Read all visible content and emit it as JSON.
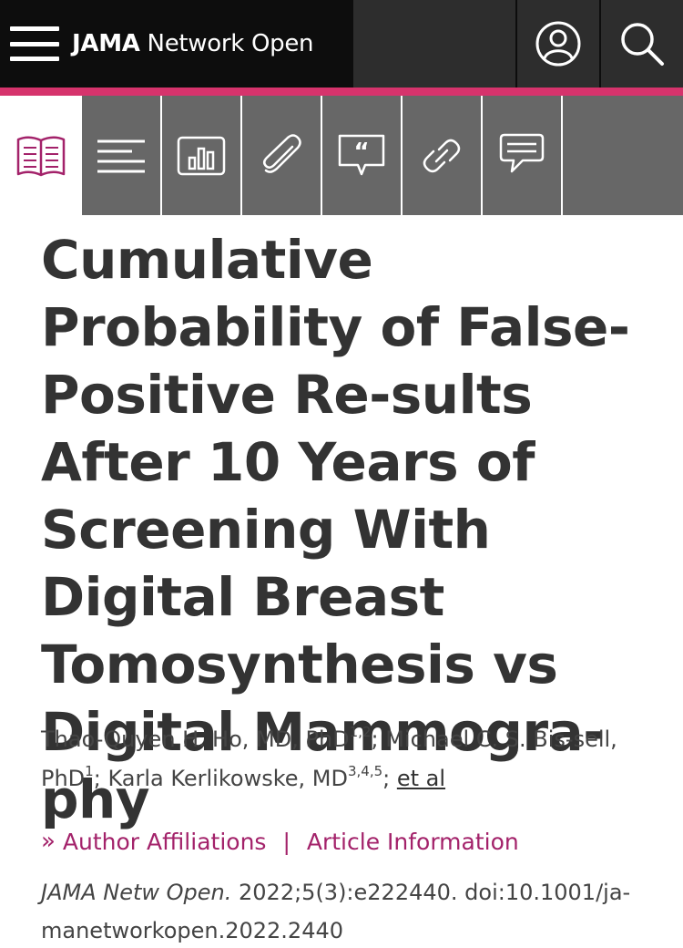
{
  "header": {
    "brand_bold": "JAMA",
    "brand_rest": " Network Open",
    "accent_color": "#d6336c",
    "icons": [
      "menu-icon",
      "user-icon",
      "search-icon"
    ]
  },
  "toolbar": {
    "tools": [
      "book-icon",
      "text-lines-icon",
      "bar-chart-icon",
      "paperclip-icon",
      "quote-icon",
      "link-icon",
      "comment-icon"
    ]
  },
  "article": {
    "title": "Cumulative Probability of False-Positive Re-sults After 10 Years of Screening With Digital Breast Tomosynthesis vs Digital Mammogra-phy",
    "authors": {
      "a1_name": "Thao-Quyen H. Ho, MD, PhD",
      "a1_sup": "1,2",
      "a1_sep": "; ",
      "a2_name": "Michael C. S. Bis-sell, PhD",
      "a2_sup": "1",
      "a2_sep": "; ",
      "a3_name": "Karla Kerlikowske, MD",
      "a3_sup": "3,4,5",
      "a3_sep": "; ",
      "etal": "et al"
    },
    "links": {
      "chevron": "»",
      "affiliations": "Author Affiliations",
      "separator": "|",
      "info": "Article Information"
    },
    "citation": {
      "journal": "JAMA Netw Open.",
      "rest": " 2022;5(3):e222440. doi:10.1001/ja-manetworkopen.2022.2440"
    }
  }
}
